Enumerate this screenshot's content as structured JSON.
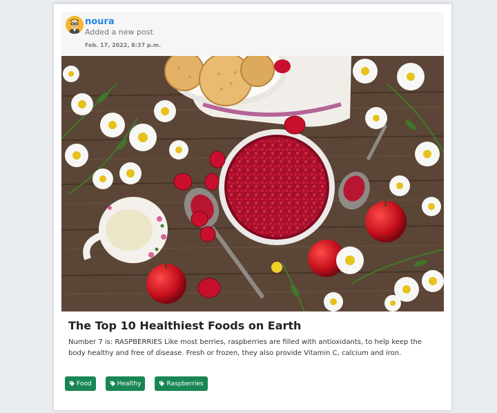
{
  "post": {
    "author": "noura",
    "action": "Added a new post",
    "timestamp": "Feb. 17, 2022, 8:37 p.m.",
    "title": "The Top 10 Healthiest Foods on Earth",
    "body": "Number 7 is: RASPBERRIES Like most berries, raspberries are filled with antioxidants, to help keep the body healthy and free of disease. Fresh or frozen, they also provide Vitamin C, calcium and iron.",
    "tags": [
      {
        "label": "Food"
      },
      {
        "label": "Healthy"
      },
      {
        "label": "Raspberries"
      }
    ]
  },
  "icons": {
    "avatar": "user-avatar-icon",
    "tag": "tag-icon"
  },
  "colors": {
    "author_link": "#1e88e5",
    "tag_background": "#198754",
    "header_background": "#f6f6f6"
  }
}
